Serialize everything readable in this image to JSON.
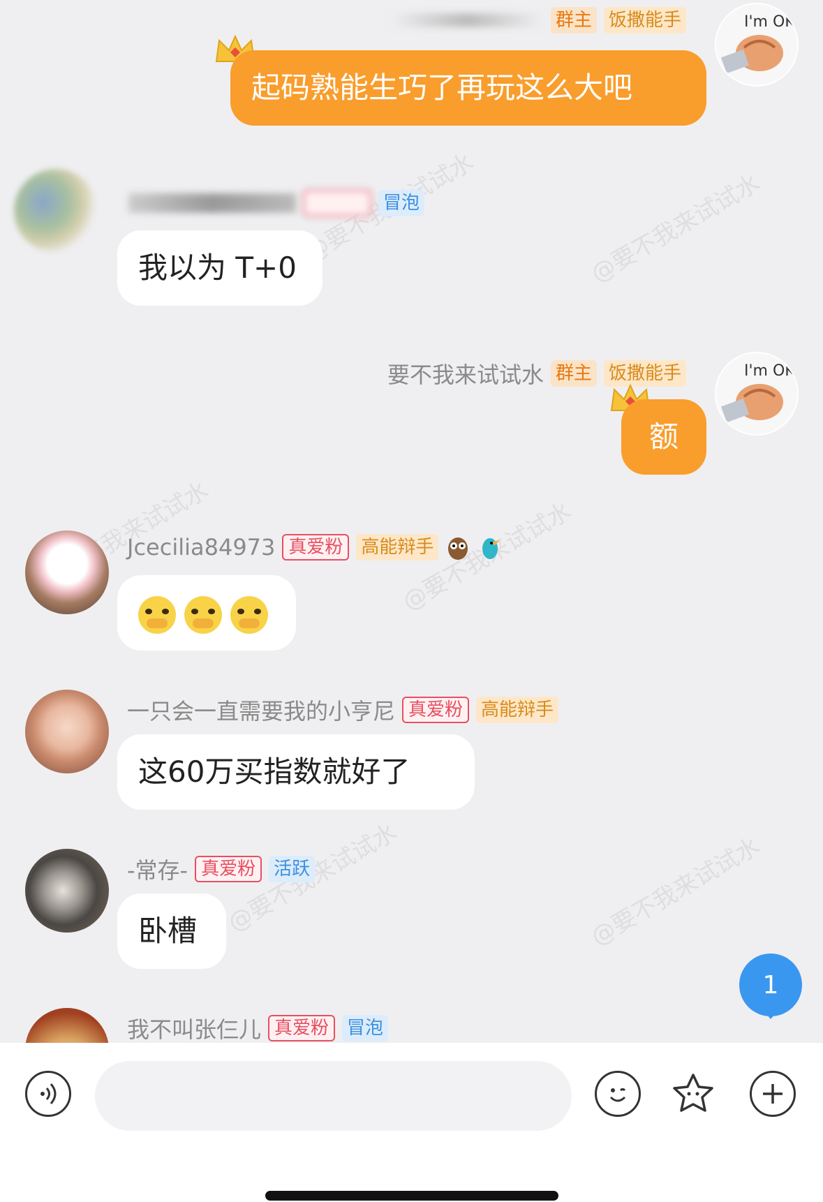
{
  "messages": [
    {
      "sender": "",
      "badges": [
        "群主",
        "饭撒能手"
      ],
      "text": "起码熟能生巧了再玩这么大吧",
      "outgoing": true
    },
    {
      "sender": "",
      "badges": [
        "冒泡"
      ],
      "text": "我以为 T+0",
      "outgoing": false
    },
    {
      "sender": "要不我来试试水",
      "badges": [
        "群主",
        "饭撒能手"
      ],
      "text": "额",
      "outgoing": true
    },
    {
      "sender": "Jcecilia84973",
      "badges": [
        "真爱粉",
        "高能辩手"
      ],
      "text": "",
      "outgoing": false,
      "emoji": [
        "cry-emoji",
        "cry-emoji",
        "cry-emoji"
      ]
    },
    {
      "sender": "一只会一直需要我的小亨尼",
      "badges": [
        "真爱粉",
        "高能辩手"
      ],
      "text": "这60万买指数就好了",
      "outgoing": false
    },
    {
      "sender": "-常存-",
      "badges": [
        "真爱粉",
        "活跃"
      ],
      "text": "卧槽",
      "outgoing": false
    },
    {
      "sender": "我不叫张仨儿",
      "badges": [
        "真爱粉",
        "冒泡"
      ],
      "text": "",
      "outgoing": false
    }
  ],
  "watermark": "@要不我来试试水",
  "unread_count": "1",
  "input": {
    "placeholder": ""
  },
  "colors": {
    "outgoing_bubble": "#f99d2c",
    "unread_badge": "#3a97f0",
    "owner_badge": "#e8790e",
    "fan_badge": "#e74f61",
    "bubble_badge": "#3d8fe0"
  }
}
